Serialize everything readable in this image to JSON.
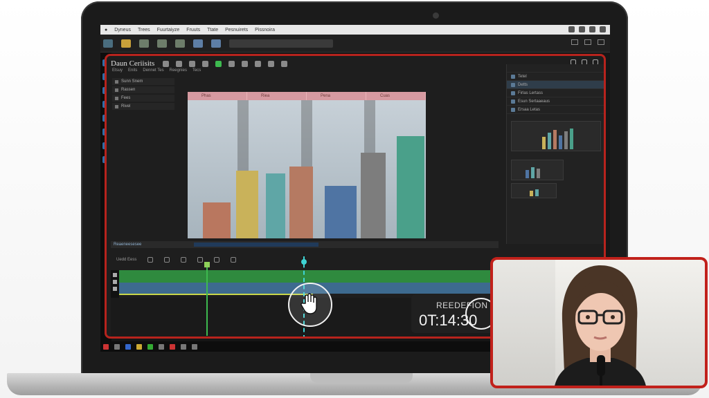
{
  "os": {
    "menu_items": [
      "Dyneus",
      "Trees",
      "Fuurtaiyze",
      "Fruuts",
      "Ttate",
      "Pesnuirets",
      "Pissnoira"
    ]
  },
  "app": {
    "title": "Daun Ceriisits",
    "tabs": [
      "Etsuy",
      "Enits",
      "Dennet Tes",
      "Reegnies",
      "Tecs"
    ],
    "effects": [
      "Sunn  Snem",
      "Rassen",
      "Fees",
      "Rivel"
    ],
    "preview_tabs": [
      "Phas",
      "Riea",
      "Pena",
      "Cuas"
    ],
    "right_panel": {
      "rows": [
        "Tetel",
        "Detts",
        "Firlas  Lertass",
        "Esun  Sertaaeaus",
        "Ersaa  Letas"
      ]
    },
    "timeline": {
      "header_label": "Reaeneesesee",
      "header_small": "Uedd  Eess"
    }
  },
  "overlay": {
    "render_label": "REEDEFION",
    "render_time": "0T:14:30"
  },
  "colors": {
    "recording_frame": "#b7231d",
    "track_video": "#2f8a3e",
    "track_audio": "#3d6a8f",
    "playhead": "#3fd4d4"
  }
}
